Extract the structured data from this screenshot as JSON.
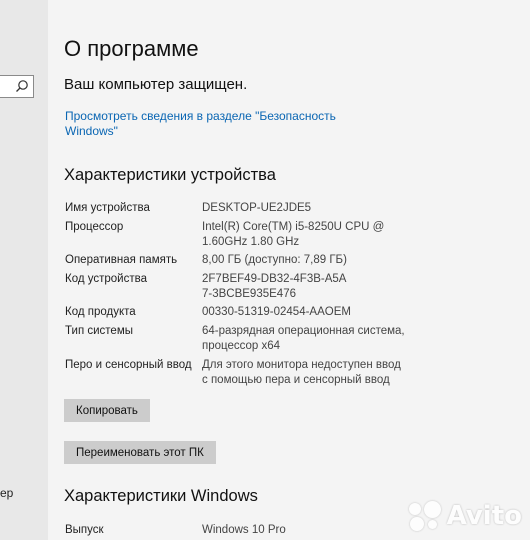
{
  "sidebar": {
    "search_icon": "search-icon",
    "label_partial": "ер"
  },
  "page": {
    "title": "О программе",
    "protected_text": "Ваш компьютер защищен.",
    "security_link": "Просмотреть сведения в разделе \"Безопасность Windows\""
  },
  "device_specs": {
    "title": "Характеристики устройства",
    "rows": [
      {
        "label": "Имя устройства",
        "value": "DESKTOP-UE2JDE5"
      },
      {
        "label": "Процессор",
        "value": "Intel(R) Core(TM) i5-8250U CPU @ 1.60GHz 1.80 GHz"
      },
      {
        "label": "Оперативная память",
        "value": "8,00 ГБ (доступно: 7,89 ГБ)"
      },
      {
        "label": "Код устройства",
        "value": "2F7BEF49-DB32-4F3B-A5A7-3BCBE935E476"
      },
      {
        "label": "Код продукта",
        "value": "00330-51319-02454-AAOEM"
      },
      {
        "label": "Тип системы",
        "value": "64-разрядная операционная система, процессор x64"
      },
      {
        "label": "Перо и сенсорный ввод",
        "value": "Для этого монитора недоступен ввод с помощью пера и сенсорный ввод"
      }
    ],
    "copy_button": "Копировать",
    "rename_button": "Переименовать этот ПК"
  },
  "windows_specs": {
    "title": "Характеристики Windows",
    "rows": [
      {
        "label": "Выпуск",
        "value": "Windows 10 Pro"
      }
    ]
  },
  "watermark": {
    "text": "Avito"
  }
}
